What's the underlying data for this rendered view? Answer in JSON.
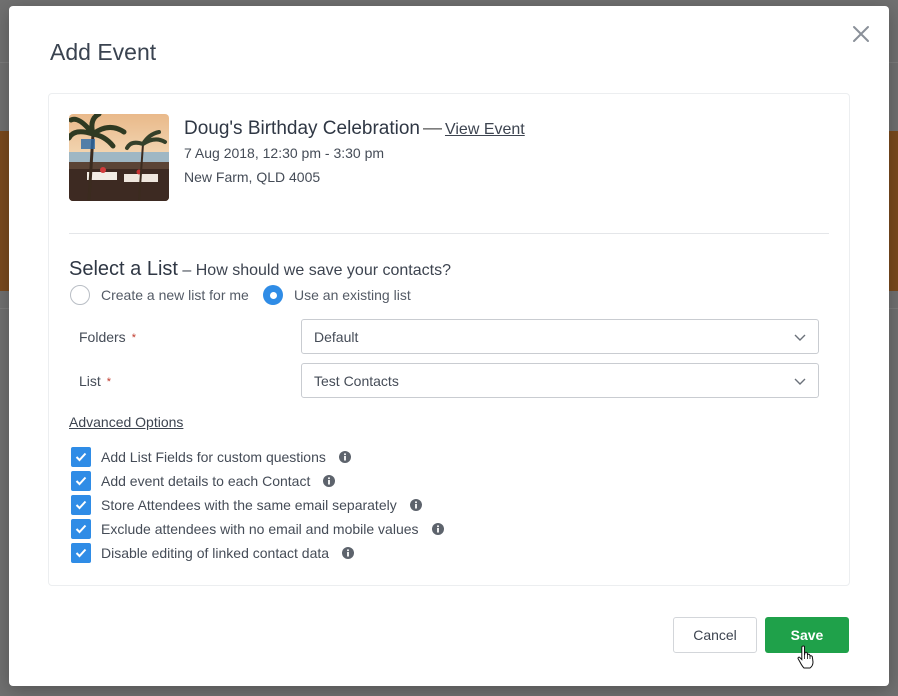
{
  "modal": {
    "title": "Add Event",
    "close_icon": "close-icon"
  },
  "event": {
    "name": "Doug's Birthday Celebration",
    "separator": "—",
    "view_link": "View Event",
    "date": "7 Aug 2018, 12:30 pm - 3:30 pm",
    "location": "New Farm, QLD 4005",
    "thumbnail": "event-photo (beach resort with palm trees at sunset)"
  },
  "select_list": {
    "title": "Select a List",
    "subtitle": " – How should we save your contacts?",
    "options": [
      {
        "label": "Create a new list for me",
        "checked": false
      },
      {
        "label": "Use an existing list",
        "checked": true
      }
    ]
  },
  "fields": {
    "folders": {
      "label": "Folders",
      "required_mark": "*",
      "value": "Default"
    },
    "list": {
      "label": "List",
      "required_mark": "*",
      "value": "Test Contacts"
    }
  },
  "advanced": {
    "link": "Advanced Options",
    "options": [
      {
        "label": "Add List Fields for custom questions",
        "checked": true
      },
      {
        "label": "Add event details to each Contact",
        "checked": true
      },
      {
        "label": "Store Attendees with the same email separately",
        "checked": true
      },
      {
        "label": "Exclude attendees with no email and mobile values",
        "checked": true
      },
      {
        "label": "Disable editing of linked contact data",
        "checked": true
      }
    ]
  },
  "buttons": {
    "cancel": "Cancel",
    "save": "Save"
  },
  "colors": {
    "accent_blue": "#2f8ce6",
    "save_green": "#1fa14a",
    "required_red": "#c0392b"
  }
}
